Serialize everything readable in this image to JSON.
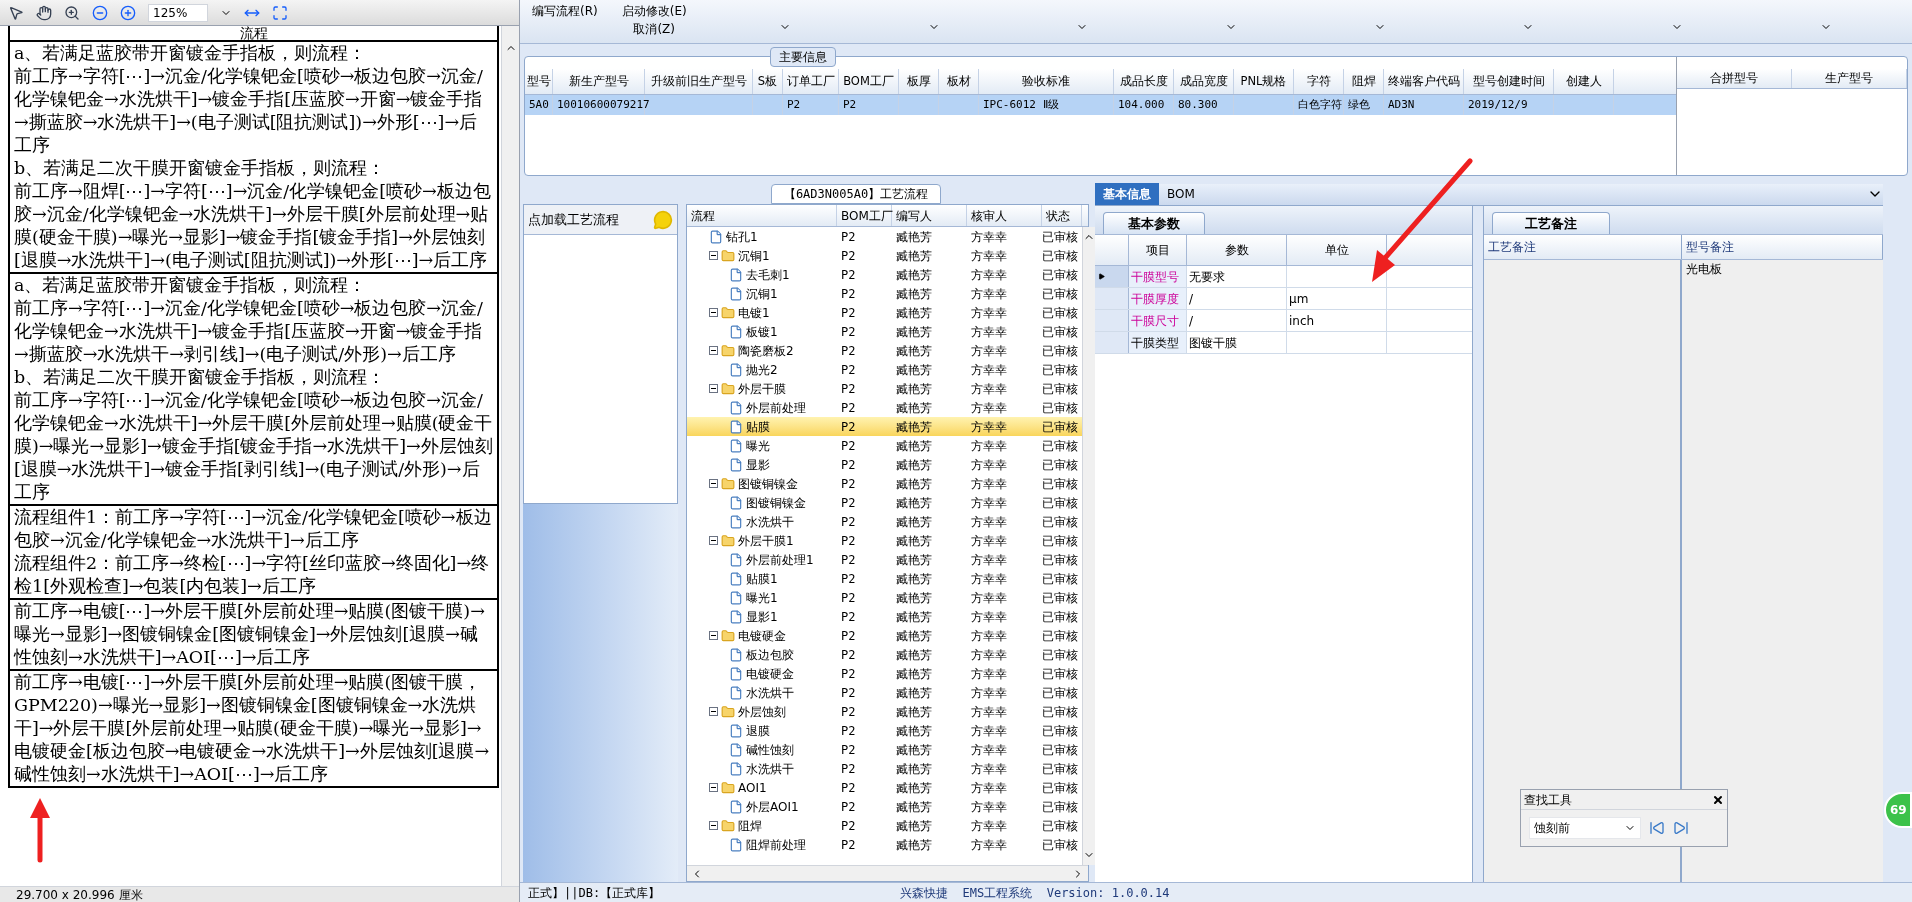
{
  "pdf_viewer": {
    "zoom": "125%",
    "header": "流程",
    "rows": [
      [
        "a、若满足蓝胶带开窗镀金手指板，则流程：",
        "前工序→字符[⋯]→沉金/化学镍钯金[喷砂→板边包胶→沉金/化学镍钯金→水洗烘干]→镀金手指[压蓝胶→开窗→镀金手指→撕蓝胶→水洗烘干]→(电子测试[阻抗测试])→外形[⋯]→后工序",
        "b、若满足二次干膜开窗镀金手指板，则流程：",
        "前工序→阻焊[⋯]→字符[⋯]→沉金/化学镍钯金[喷砂→板边包胶→沉金/化学镍钯金→水洗烘干]→外层干膜[外层前处理→贴膜(硬金干膜)→曝光→显影]→镀金手指[镀金手指]→外层蚀刻[退膜→水洗烘干]→(电子测试[阻抗测试])→外形[⋯]→后工序"
      ],
      [
        "a、若满足蓝胶带开窗镀金手指板，则流程：",
        "前工序→字符[⋯]→沉金/化学镍钯金[喷砂→板边包胶→沉金/化学镍钯金→水洗烘干]→镀金手指[压蓝胶→开窗→镀金手指→撕蓝胶→水洗烘干→剥引线]→(电子测试/外形)→后工序",
        "b、若满足二次干膜开窗镀金手指板，则流程：",
        "前工序→字符[⋯]→沉金/化学镍钯金[喷砂→板边包胶→沉金/化学镍钯金→水洗烘干]→外层干膜[外层前处理→贴膜(硬金干膜)→曝光→显影]→镀金手指[镀金手指→水洗烘干]→外层蚀刻[退膜→水洗烘干]→镀金手指[剥引线]→(电子测试/外形)→后工序"
      ],
      [
        "流程组件1：前工序→字符[⋯]→沉金/化学镍钯金[喷砂→板边包胶→沉金/化学镍钯金→水洗烘干]→后工序",
        "流程组件2：前工序→终检[⋯]→字符[丝印蓝胶→终固化]→终检1[外观检查]→包装[内包装]→后工序"
      ],
      [
        "前工序→电镀[⋯]→外层干膜[外层前处理→贴膜(图镀干膜)→曝光→显影]→图镀铜镍金[图镀铜镍金]→外层蚀刻[退膜→碱性蚀刻→水洗烘干]→AOI[⋯]→后工序"
      ],
      [
        "前工序→电镀[⋯]→外层干膜[外层前处理→贴膜(图镀干膜，GPM220)→曝光→显影]→图镀铜镍金[图镀铜镍金→水洗烘干]→外层干膜[外层前处理→贴膜(硬金干膜)→曝光→显影]→电镀硬金[板边包胶→电镀硬金→水洗烘干]→外层蚀刻[退膜→碱性蚀刻→水洗烘干]→AOI[⋯]→后工序"
      ]
    ],
    "page_size": "29.700 x 20.996 厘米"
  },
  "toolbar": {
    "buttons": [
      "编写流程(R)",
      "启动修改(E)",
      "取消(Z)"
    ]
  },
  "main_info": {
    "title": "主要信息",
    "columns": [
      "型号",
      "新生产型号",
      "升级前旧生产型号",
      "S板",
      "订单工厂",
      "BOM工厂",
      "板厚",
      "板材",
      "验收标准",
      "成品长度",
      "成品宽度",
      "PNL规格",
      "字符",
      "阻焊",
      "终端客户代码",
      "型号创建时间",
      "创建人"
    ],
    "rows": [
      {
        "cells": [
          "5A0",
          "10010600079217",
          null,
          null,
          "P2",
          "P2",
          null,
          null,
          "IPC-6012 Ⅱ级",
          "104.000",
          "80.300",
          null,
          "白色字符",
          "绿色",
          "AD3N",
          "2019/12/9",
          null
        ],
        "selected": true
      }
    ],
    "side_columns": [
      "合拼型号",
      "生产型号"
    ]
  },
  "flow_panel": {
    "title": "【6AD3N005A0】工艺流程",
    "hint": "点加载工艺流程",
    "columns": [
      "流程",
      "BOM工厂",
      "编写人",
      "核审人",
      "状态"
    ],
    "tree": [
      {
        "kind": "file",
        "name": "钻孔1",
        "bom": "P2",
        "writer": "臧艳芳",
        "reviewer": "方幸幸",
        "status": "已审核",
        "selected": false
      },
      {
        "kind": "folder",
        "name": "沉铜1",
        "bom": "P2",
        "writer": "臧艳芳",
        "reviewer": "方幸幸",
        "status": "已审核",
        "selected": false,
        "expanded": true,
        "children": [
          {
            "kind": "file",
            "name": "去毛刺1",
            "bom": "P2",
            "writer": "臧艳芳",
            "reviewer": "方幸幸",
            "status": "已审核",
            "selected": false
          },
          {
            "kind": "file",
            "name": "沉铜1",
            "bom": "P2",
            "writer": "臧艳芳",
            "reviewer": "方幸幸",
            "status": "已审核",
            "selected": false
          }
        ]
      },
      {
        "kind": "folder",
        "name": "电镀1",
        "bom": "P2",
        "writer": "臧艳芳",
        "reviewer": "方幸幸",
        "status": "已审核",
        "selected": false,
        "expanded": true,
        "children": [
          {
            "kind": "file",
            "name": "板镀1",
            "bom": "P2",
            "writer": "臧艳芳",
            "reviewer": "方幸幸",
            "status": "已审核",
            "selected": false
          }
        ]
      },
      {
        "kind": "folder",
        "name": "陶瓷磨板2",
        "bom": "P2",
        "writer": "臧艳芳",
        "reviewer": "方幸幸",
        "status": "已审核",
        "selected": false,
        "expanded": true,
        "children": [
          {
            "kind": "file",
            "name": "抛光2",
            "bom": "P2",
            "writer": "臧艳芳",
            "reviewer": "方幸幸",
            "status": "已审核",
            "selected": false
          }
        ]
      },
      {
        "kind": "folder",
        "name": "外层干膜",
        "bom": "P2",
        "writer": "臧艳芳",
        "reviewer": "方幸幸",
        "status": "已审核",
        "selected": false,
        "expanded": true,
        "children": [
          {
            "kind": "file",
            "name": "外层前处理",
            "bom": "P2",
            "writer": "臧艳芳",
            "reviewer": "方幸幸",
            "status": "已审核",
            "selected": false
          },
          {
            "kind": "file",
            "name": "贴膜",
            "bom": "P2",
            "writer": "臧艳芳",
            "reviewer": "方幸幸",
            "status": "已审核",
            "selected": true
          },
          {
            "kind": "file",
            "name": "曝光",
            "bom": "P2",
            "writer": "臧艳芳",
            "reviewer": "方幸幸",
            "status": "已审核",
            "selected": false
          },
          {
            "kind": "file",
            "name": "显影",
            "bom": "P2",
            "writer": "臧艳芳",
            "reviewer": "方幸幸",
            "status": "已审核",
            "selected": false
          }
        ]
      },
      {
        "kind": "folder",
        "name": "图镀铜镍金",
        "bom": "P2",
        "writer": "臧艳芳",
        "reviewer": "方幸幸",
        "status": "已审核",
        "selected": false,
        "expanded": true,
        "children": [
          {
            "kind": "file",
            "name": "图镀铜镍金",
            "bom": "P2",
            "writer": "臧艳芳",
            "reviewer": "方幸幸",
            "status": "已审核",
            "selected": false
          },
          {
            "kind": "file",
            "name": "水洗烘干",
            "bom": "P2",
            "writer": "臧艳芳",
            "reviewer": "方幸幸",
            "status": "已审核",
            "selected": false
          }
        ]
      },
      {
        "kind": "folder",
        "name": "外层干膜1",
        "bom": "P2",
        "writer": "臧艳芳",
        "reviewer": "方幸幸",
        "status": "已审核",
        "selected": false,
        "expanded": true,
        "children": [
          {
            "kind": "file",
            "name": "外层前处理1",
            "bom": "P2",
            "writer": "臧艳芳",
            "reviewer": "方幸幸",
            "status": "已审核",
            "selected": false
          },
          {
            "kind": "file",
            "name": "贴膜1",
            "bom": "P2",
            "writer": "臧艳芳",
            "reviewer": "方幸幸",
            "status": "已审核",
            "selected": false
          },
          {
            "kind": "file",
            "name": "曝光1",
            "bom": "P2",
            "writer": "臧艳芳",
            "reviewer": "方幸幸",
            "status": "已审核",
            "selected": false
          },
          {
            "kind": "file",
            "name": "显影1",
            "bom": "P2",
            "writer": "臧艳芳",
            "reviewer": "方幸幸",
            "status": "已审核",
            "selected": false
          }
        ]
      },
      {
        "kind": "folder",
        "name": "电镀硬金",
        "bom": "P2",
        "writer": "臧艳芳",
        "reviewer": "方幸幸",
        "status": "已审核",
        "selected": false,
        "expanded": true,
        "children": [
          {
            "kind": "file",
            "name": "板边包胶",
            "bom": "P2",
            "writer": "臧艳芳",
            "reviewer": "方幸幸",
            "status": "已审核",
            "selected": false
          },
          {
            "kind": "file",
            "name": "电镀硬金",
            "bom": "P2",
            "writer": "臧艳芳",
            "reviewer": "方幸幸",
            "status": "已审核",
            "selected": false
          },
          {
            "kind": "file",
            "name": "水洗烘干",
            "bom": "P2",
            "writer": "臧艳芳",
            "reviewer": "方幸幸",
            "status": "已审核",
            "selected": false
          }
        ]
      },
      {
        "kind": "folder",
        "name": "外层蚀刻",
        "bom": "P2",
        "writer": "臧艳芳",
        "reviewer": "方幸幸",
        "status": "已审核",
        "selected": false,
        "expanded": true,
        "children": [
          {
            "kind": "file",
            "name": "退膜",
            "bom": "P2",
            "writer": "臧艳芳",
            "reviewer": "方幸幸",
            "status": "已审核",
            "selected": false
          },
          {
            "kind": "file",
            "name": "碱性蚀刻",
            "bom": "P2",
            "writer": "臧艳芳",
            "reviewer": "方幸幸",
            "status": "已审核",
            "selected": false
          },
          {
            "kind": "file",
            "name": "水洗烘干",
            "bom": "P2",
            "writer": "臧艳芳",
            "reviewer": "方幸幸",
            "status": "已审核",
            "selected": false
          }
        ]
      },
      {
        "kind": "folder",
        "name": "AOI1",
        "bom": "P2",
        "writer": "臧艳芳",
        "reviewer": "方幸幸",
        "status": "已审核",
        "selected": false,
        "expanded": true,
        "children": [
          {
            "kind": "file",
            "name": "外层AOI1",
            "bom": "P2",
            "writer": "臧艳芳",
            "reviewer": "方幸幸",
            "status": "已审核",
            "selected": false
          }
        ]
      },
      {
        "kind": "folder",
        "name": "阻焊",
        "bom": "P2",
        "writer": "臧艳芳",
        "reviewer": "方幸幸",
        "status": "已审核",
        "selected": false,
        "expanded": true,
        "children": [
          {
            "kind": "file",
            "name": "阻焊前处理",
            "bom": "P2",
            "writer": "臧艳芳",
            "reviewer": "方幸幸",
            "status": "已审核",
            "selected": false
          }
        ]
      }
    ]
  },
  "detail": {
    "tabs": [
      {
        "label": "基本信息",
        "selected": true
      },
      {
        "label": "BOM",
        "selected": false
      }
    ],
    "params": {
      "tab": "基本参数",
      "columns": [
        "项目",
        "参数",
        "单位"
      ],
      "rows": [
        {
          "cells": [
            "干膜型号",
            "无要求",
            null
          ],
          "required": true,
          "current": true
        },
        {
          "cells": [
            "干膜厚度",
            "/",
            "μm"
          ],
          "required": true,
          "current": false
        },
        {
          "cells": [
            "干膜尺寸",
            "/",
            "inch"
          ],
          "required": true,
          "current": false
        },
        {
          "cells": [
            "干膜类型",
            "图镀干膜",
            null
          ],
          "required": false,
          "current": false
        }
      ]
    },
    "remarks": {
      "tab": "工艺备注",
      "columns": [
        "工艺备注",
        "型号备注"
      ],
      "model_remark": "光电板"
    }
  },
  "find_tool": {
    "title": "查找工具",
    "value": "蚀刻前"
  },
  "status_bar": {
    "left": "正式】||DB:【正式库】",
    "center": "兴森快捷  EMS工程系统  Version: 1.0.0.14"
  },
  "badge": "69"
}
